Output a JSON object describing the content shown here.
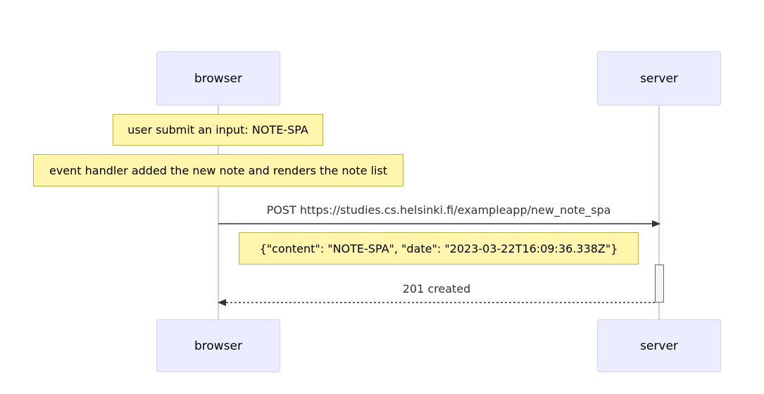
{
  "participants": {
    "browser": {
      "label": "browser"
    },
    "server": {
      "label": "server"
    }
  },
  "notes": [
    {
      "text": "user submit an input: NOTE-SPA"
    },
    {
      "text": "event handler added the new note and renders the note list"
    },
    {
      "text": "{\"content\": \"NOTE-SPA\", \"date\": \"2023-03-22T16:09:36.338Z\"}"
    }
  ],
  "messages": [
    {
      "text": "POST https://studies.cs.helsinki.fi/exampleapp/new_note_spa",
      "from": "browser",
      "to": "server",
      "style": "solid"
    },
    {
      "text": "201 created",
      "from": "server",
      "to": "browser",
      "style": "dashed"
    }
  ],
  "colors": {
    "actor_fill": "#ececff",
    "actor_border": "#d5d0f3",
    "lifeline": "#d9c9ee",
    "note_fill": "#fff5ad",
    "note_border": "#b9b04a",
    "arrow": "#333333"
  }
}
